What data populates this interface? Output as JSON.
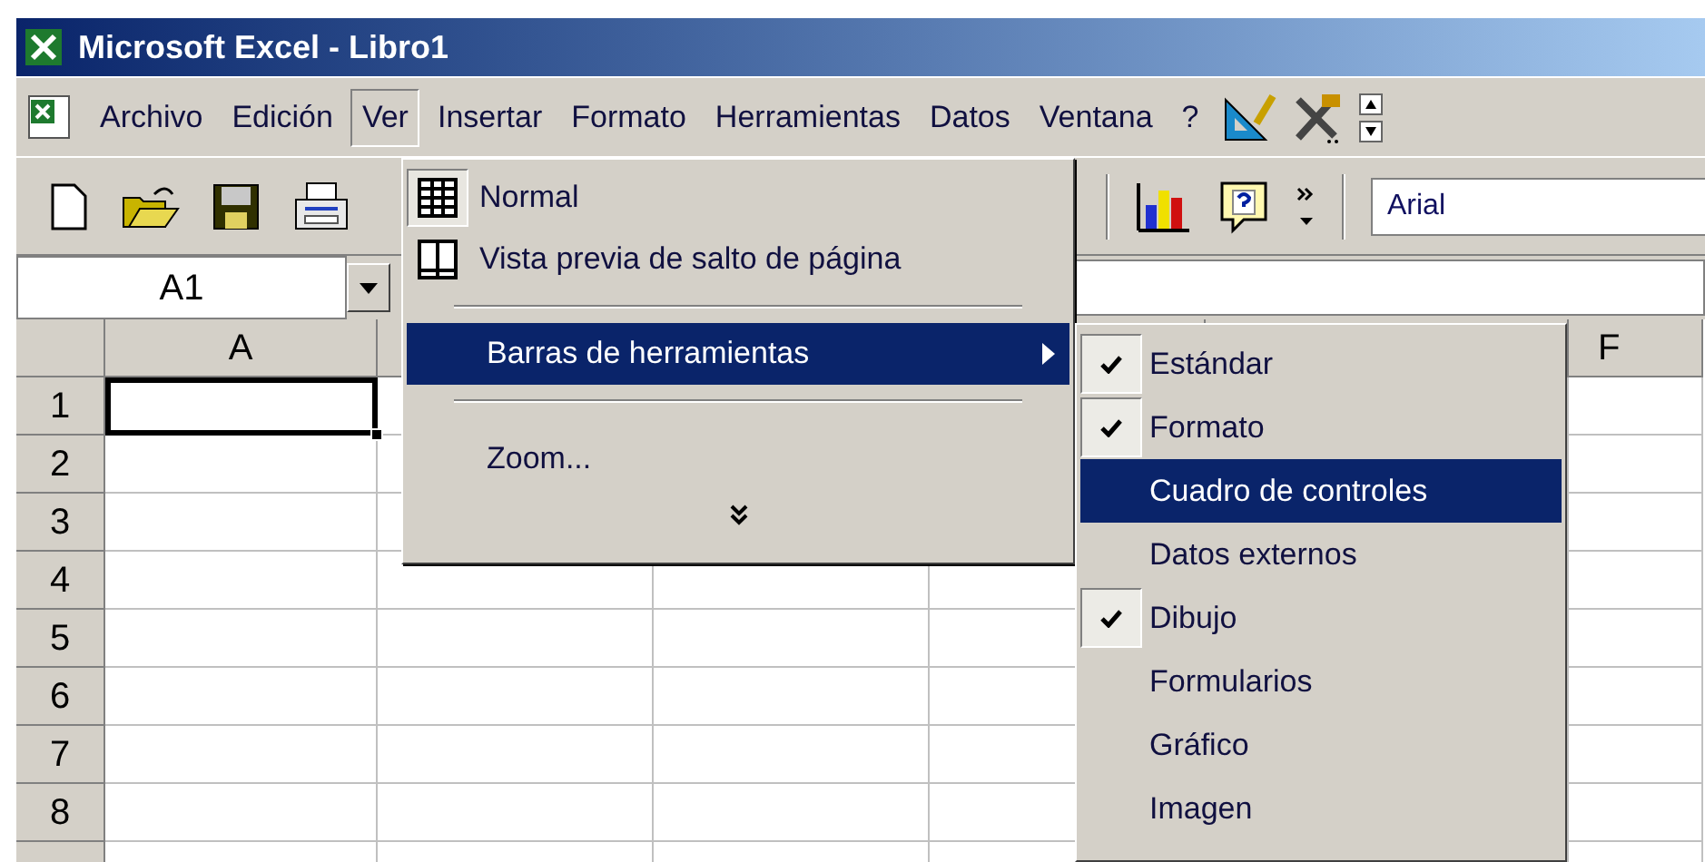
{
  "window": {
    "title": "Microsoft Excel - Libro1"
  },
  "menu_bar": [
    {
      "label": "Archivo",
      "selected": false
    },
    {
      "label": "Edición",
      "selected": false
    },
    {
      "label": "Ver",
      "selected": true
    },
    {
      "label": "Insertar",
      "selected": false
    },
    {
      "label": "Formato",
      "selected": false
    },
    {
      "label": "Herramientas",
      "selected": false
    },
    {
      "label": "Datos",
      "selected": false
    },
    {
      "label": "Ventana",
      "selected": false
    },
    {
      "label": "?",
      "selected": false
    }
  ],
  "toolbar": {
    "font_field": {
      "value": "Arial"
    }
  },
  "name_box": {
    "value": "A1"
  },
  "sheet": {
    "column_headers": [
      {
        "label": "A"
      },
      {
        "label": "F"
      }
    ],
    "rows": [
      {
        "label": "1",
        "active": true
      },
      {
        "label": "2",
        "active": false
      },
      {
        "label": "3",
        "active": false
      },
      {
        "label": "4",
        "active": false
      },
      {
        "label": "5",
        "active": false
      },
      {
        "label": "6",
        "active": false
      },
      {
        "label": "7",
        "active": false
      },
      {
        "label": "8",
        "active": false
      }
    ]
  },
  "ver_menu": {
    "items": [
      {
        "kind": "icon-item",
        "label": "Normal",
        "checked": true
      },
      {
        "kind": "icon-item",
        "label": "Vista previa de salto de página",
        "checked": false
      },
      {
        "kind": "separator"
      },
      {
        "kind": "submenu",
        "label": "Barras de herramientas",
        "selected": true
      },
      {
        "kind": "separator"
      },
      {
        "kind": "item",
        "label": "Zoom..."
      },
      {
        "kind": "more"
      }
    ]
  },
  "toolbars_submenu": {
    "items": [
      {
        "label": "Estándar",
        "checked": true,
        "selected": false
      },
      {
        "label": "Formato",
        "checked": true,
        "selected": false
      },
      {
        "label": "Cuadro de controles",
        "checked": false,
        "selected": true
      },
      {
        "label": "Datos externos",
        "checked": false,
        "selected": false
      },
      {
        "label": "Dibujo",
        "checked": true,
        "selected": false
      },
      {
        "label": "Formularios",
        "checked": false,
        "selected": false
      },
      {
        "label": "Gráfico",
        "checked": false,
        "selected": false
      },
      {
        "label": "Imagen",
        "checked": false,
        "selected": false
      }
    ]
  }
}
